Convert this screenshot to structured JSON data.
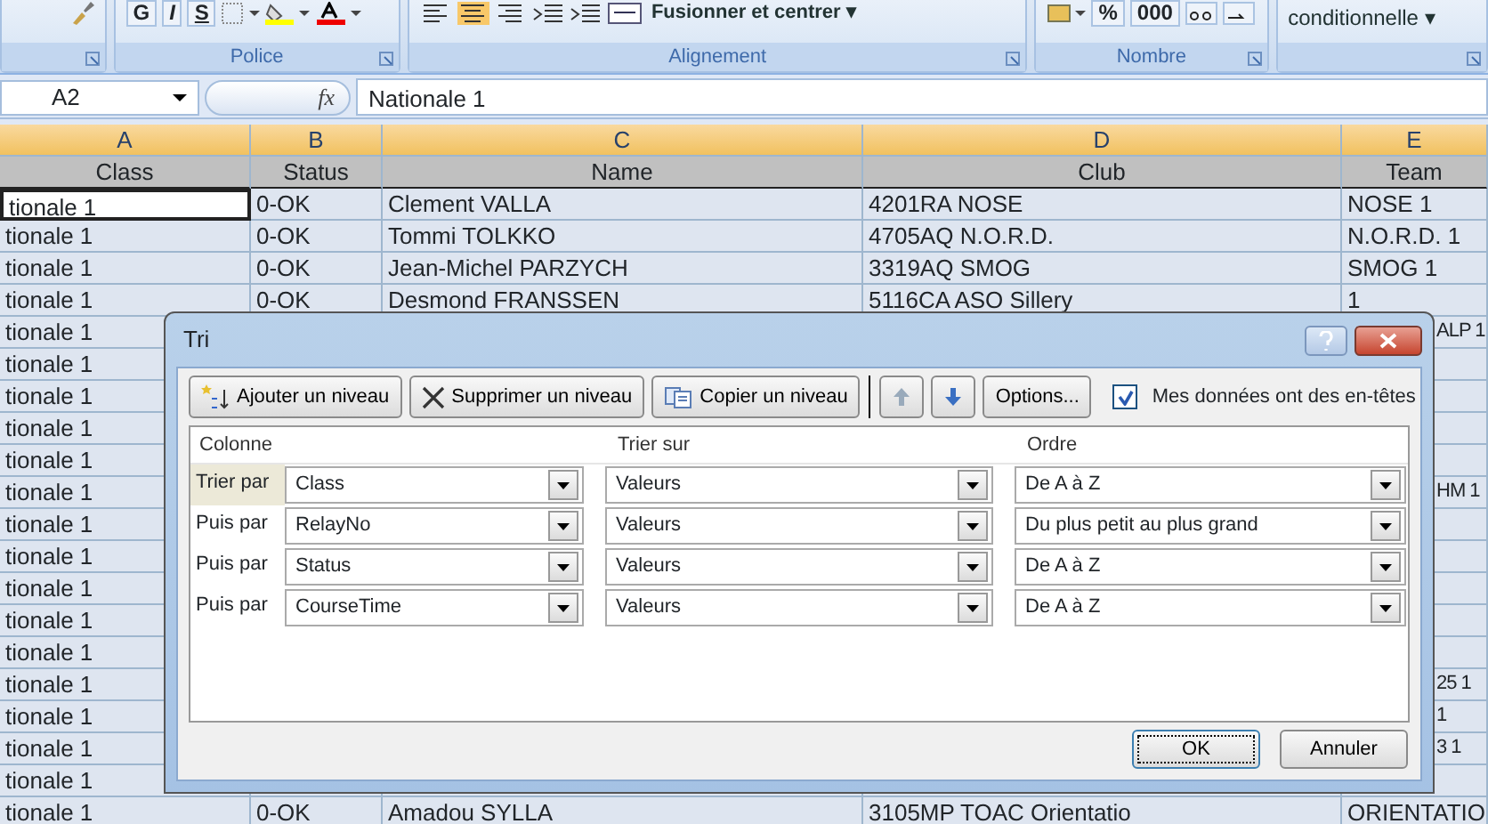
{
  "ribbon": {
    "groups": [
      {
        "kind": "clipboard"
      },
      {
        "kind": "font",
        "label": "Police",
        "buttons": [
          "G",
          "I",
          "S"
        ]
      },
      {
        "kind": "alignment",
        "label": "Alignement",
        "merge_button": "Fusionner et centrer ▾"
      },
      {
        "kind": "number",
        "label": "Nombre",
        "buttons": [
          "%",
          "000"
        ]
      },
      {
        "kind": "styles",
        "button": "conditionnelle ▾"
      }
    ]
  },
  "formula_bar": {
    "name_box": "A2",
    "function_label": "fx",
    "value": "Nationale 1"
  },
  "columns": [
    {
      "letter": "A",
      "selected": true
    },
    {
      "letter": "B",
      "selected": true
    },
    {
      "letter": "C",
      "selected": true
    },
    {
      "letter": "D",
      "selected": true
    },
    {
      "letter": "E",
      "selected": true
    }
  ],
  "header_row": [
    "Class",
    "Status",
    "Name",
    "Club",
    "Team"
  ],
  "rows": [
    {
      "class": "tionale 1",
      "status": "0-OK",
      "name": "Clement VALLA",
      "club": "4201RA NOSE",
      "team": "NOSE 1",
      "active": true
    },
    {
      "class": "tionale 1",
      "status": "0-OK",
      "name": "Tommi TOLKKO",
      "club": "4705AQ N.O.R.D.",
      "team": "N.O.R.D. 1",
      "active": false
    },
    {
      "class": "tionale 1",
      "status": "0-OK",
      "name": "Jean-Michel PARZYCH",
      "club": "3319AQ SMOG",
      "team": "SMOG 1",
      "active": false
    },
    {
      "class": "tionale 1",
      "status": "0-OK",
      "name": "Desmond FRANSSEN",
      "club": "5116CA ASO Sillery",
      "team": "1",
      "active": false
    },
    {
      "class": "tionale 1",
      "team": "ALP 1",
      "active": false
    },
    {
      "class": "tionale 1",
      "active": false
    },
    {
      "class": "tionale 1",
      "active": false
    },
    {
      "class": "tionale 1",
      "active": false
    },
    {
      "class": "tionale 1",
      "active": false
    },
    {
      "class": "tionale 1",
      "team": "HM 1",
      "active": false
    },
    {
      "class": "tionale 1",
      "active": false
    },
    {
      "class": "tionale 1",
      "active": false
    },
    {
      "class": "tionale 1",
      "active": false
    },
    {
      "class": "tionale 1",
      "active": false
    },
    {
      "class": "tionale 1",
      "active": false
    },
    {
      "class": "tionale 1",
      "team": "25 1",
      "active": false
    },
    {
      "class": "tionale 1",
      "team": "1",
      "active": false
    },
    {
      "class": "tionale 1",
      "team": "3 1",
      "active": false
    },
    {
      "class": "tionale 1",
      "active": false
    },
    {
      "class": "tionale 1",
      "status": "0-OK",
      "name": "Amadou SYLLA",
      "club": "3105MP TOAC Orientatio",
      "team": "ORIENTATIO",
      "active": false
    }
  ],
  "dialog": {
    "title": "Tri",
    "toolbar": [
      {
        "kind": "add",
        "label": "Ajouter un niveau"
      },
      {
        "kind": "delete",
        "label": "Supprimer un niveau"
      },
      {
        "kind": "copy",
        "label": "Copier un niveau"
      },
      {
        "kind": "up"
      },
      {
        "kind": "down"
      },
      {
        "kind": "options",
        "label": "Options..."
      }
    ],
    "headers_checkbox": {
      "label": "Mes données ont des en-têtes",
      "checked": true
    },
    "columns": [
      "Colonne",
      "Trier sur",
      "Ordre"
    ],
    "levels": [
      {
        "label": "Trier par",
        "column": "Class",
        "sort_on": "Valeurs",
        "order": "De A à Z",
        "selected": true
      },
      {
        "label": "Puis par",
        "column": "RelayNo",
        "sort_on": "Valeurs",
        "order": "Du plus petit au plus grand",
        "selected": false
      },
      {
        "label": "Puis par",
        "column": "Status",
        "sort_on": "Valeurs",
        "order": "De A à Z",
        "selected": false
      },
      {
        "label": "Puis par",
        "column": "CourseTime",
        "sort_on": "Valeurs",
        "order": "De A à Z",
        "selected": false
      }
    ],
    "buttons": [
      {
        "kind": "ok",
        "label": "OK"
      },
      {
        "kind": "cancel",
        "label": "Annuler"
      }
    ]
  }
}
